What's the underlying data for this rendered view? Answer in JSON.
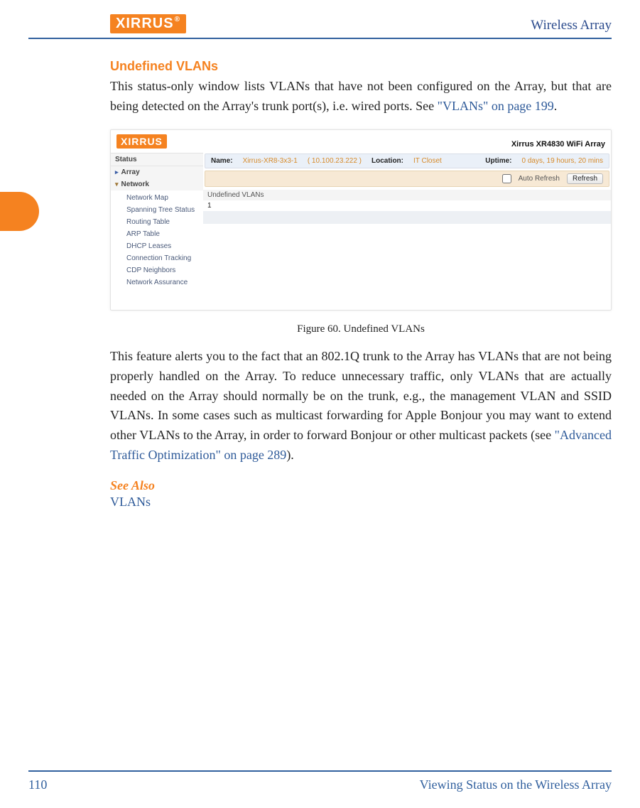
{
  "header": {
    "logo_text": "XIRRUS",
    "product": "Wireless Array"
  },
  "section": {
    "title": "Undefined VLANs",
    "para1_pre": "This status-only window lists VLANs that have not been configured on the Array, but that are being detected on the Array's trunk port(s), i.e. wired ports. See ",
    "para1_link": "\"VLANs\" on page 199",
    "para1_post": ".",
    "fig_caption": "Figure 60. Undefined VLANs",
    "para2_pre": "This feature alerts you to the fact that an 802.1Q trunk to the Array has VLANs that are not being properly handled on the Array. To reduce unnecessary traffic, only VLANs that are actually needed on the Array should normally be on the trunk, e.g., the management VLAN and SSID VLANs. In some cases such as multicast forwarding for Apple Bonjour you may want to extend other VLANs to the Array, in order to forward Bonjour or other multicast packets (see ",
    "para2_link": "\"Advanced Traffic Optimization\" on page 289",
    "para2_post": ").",
    "see_also_heading": "See Also",
    "see_also_link": "VLANs"
  },
  "screenshot": {
    "logo": "XIRRUS",
    "model": "Xirrus XR4830 WiFi Array",
    "status_bar": {
      "name_label": "Name:",
      "name_value": "Xirrus-XR8-3x3-1",
      "ip_value": "( 10.100.23.222 )",
      "location_label": "Location:",
      "location_value": "IT Closet",
      "uptime_label": "Uptime:",
      "uptime_value": "0 days, 19 hours, 20 mins"
    },
    "toolbar": {
      "auto_refresh_label": "Auto Refresh",
      "refresh_button": "Refresh"
    },
    "sidebar": {
      "status_label": "Status",
      "array_label": "Array",
      "network_label": "Network",
      "items": [
        "Network Map",
        "Spanning Tree Status",
        "Routing Table",
        "ARP Table",
        "DHCP Leases",
        "Connection Tracking",
        "CDP Neighbors",
        "Network Assurance"
      ]
    },
    "table": {
      "header": "Undefined VLANs",
      "rows": [
        "1"
      ]
    }
  },
  "footer": {
    "page_number": "110",
    "chapter": "Viewing Status on the Wireless Array"
  }
}
